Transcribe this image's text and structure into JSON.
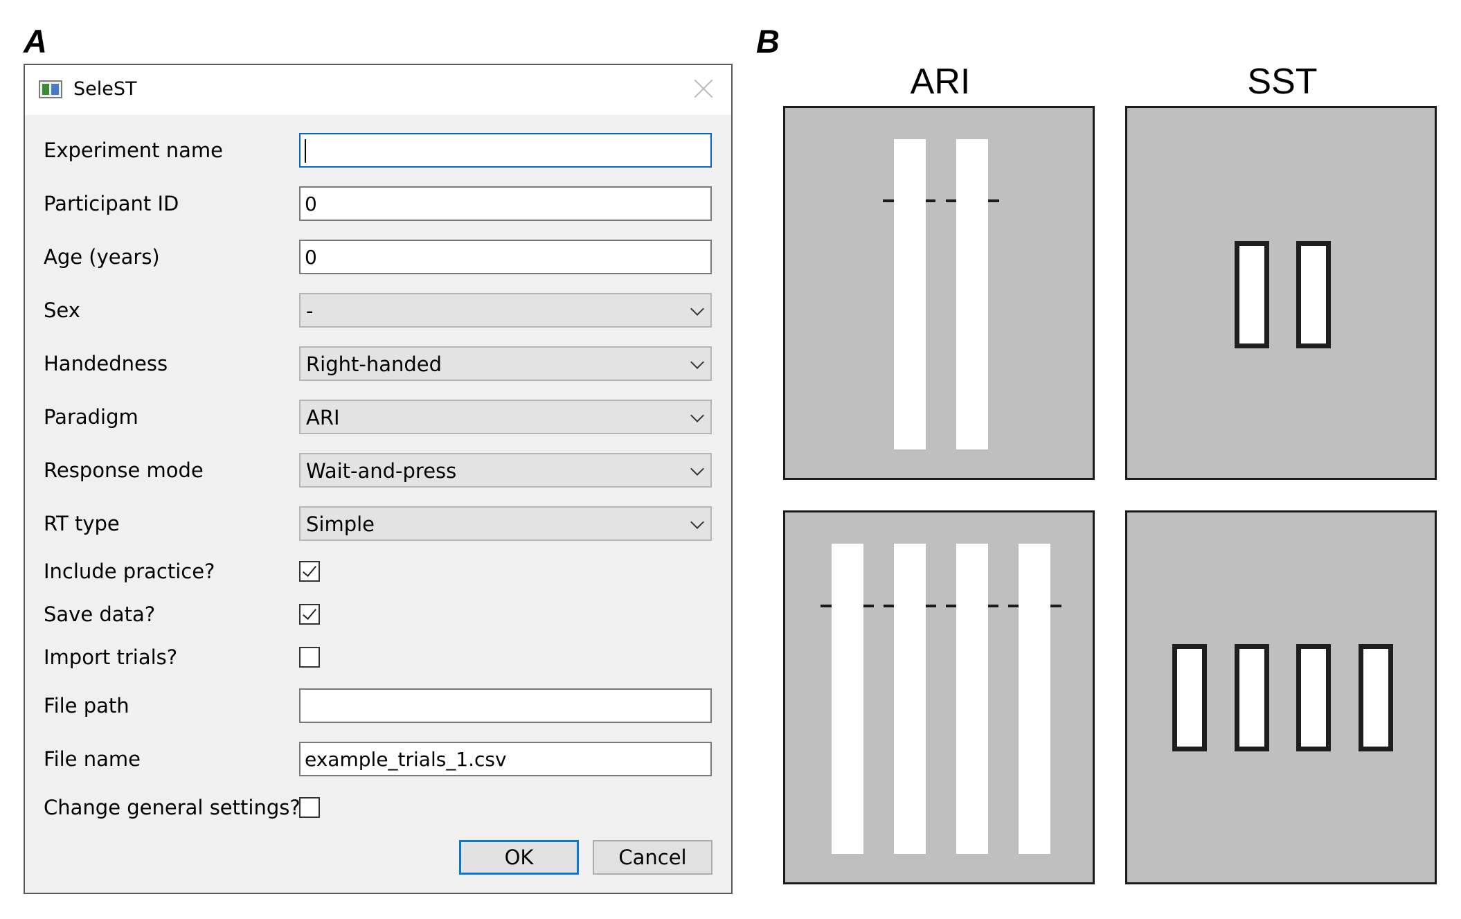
{
  "panels": {
    "a_label": "A",
    "b_label": "B"
  },
  "dialog": {
    "title": "SeleST",
    "fields": {
      "experiment_name": {
        "label": "Experiment name",
        "value": ""
      },
      "participant_id": {
        "label": "Participant ID",
        "value": "0"
      },
      "age": {
        "label": "Age (years)",
        "value": "0"
      },
      "sex": {
        "label": "Sex",
        "value": "-"
      },
      "handedness": {
        "label": "Handedness",
        "value": "Right-handed"
      },
      "paradigm": {
        "label": "Paradigm",
        "value": "ARI"
      },
      "response_mode": {
        "label": "Response mode",
        "value": "Wait-and-press"
      },
      "rt_type": {
        "label": "RT type",
        "value": "Simple"
      },
      "include_practice": {
        "label": "Include practice?",
        "checked": true
      },
      "save_data": {
        "label": "Save data?",
        "checked": true
      },
      "import_trials": {
        "label": "Import trials?",
        "checked": false
      },
      "file_path": {
        "label": "File path",
        "value": ""
      },
      "file_name": {
        "label": "File name",
        "value": "example_trials_1.csv"
      },
      "change_general_settings": {
        "label": "Change general settings?",
        "checked": false
      }
    },
    "buttons": {
      "ok": "OK",
      "cancel": "Cancel"
    }
  },
  "stimuli": {
    "ari_heading": "ARI",
    "sst_heading": "SST",
    "colors": {
      "screen_bg": "#bfbfbf",
      "bar": "#ffffff",
      "outline": "#1e1e1e"
    }
  }
}
